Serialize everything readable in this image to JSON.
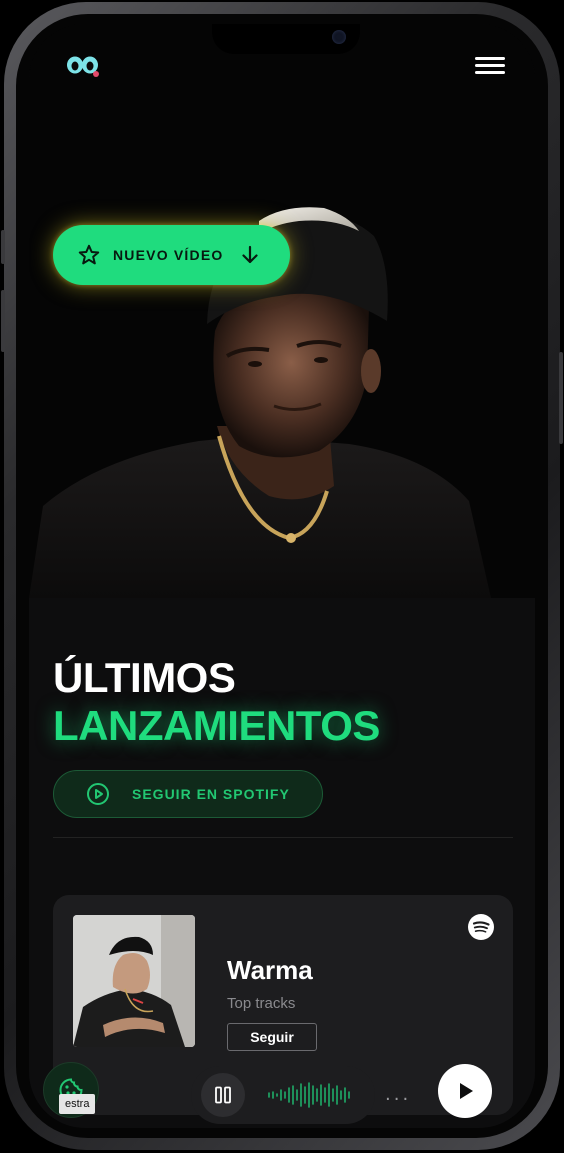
{
  "header": {
    "logo_icon": "brand-logo-icon",
    "menu_icon": "hamburger-menu-icon"
  },
  "hero": {
    "cta_label": "NUEVO VÍDEO",
    "cta_star_icon": "star-icon",
    "cta_arrow_icon": "arrow-down-icon",
    "accent_color": "#1fdc7e"
  },
  "releases": {
    "title_line1": "ÚLTIMOS",
    "title_line2": "LANZAMIENTOS",
    "spotify_button": "SEGUIR EN SPOTIFY"
  },
  "artist_card": {
    "name": "Warma",
    "subtitle": "Top tracks",
    "follow_label": "Seguir",
    "platform_icon": "spotify-icon"
  },
  "player": {
    "preview_tag": "estra",
    "more_label": "...",
    "pause_icon": "pause-icon",
    "play_icon": "play-icon",
    "cookie_icon": "cookie-icon"
  }
}
